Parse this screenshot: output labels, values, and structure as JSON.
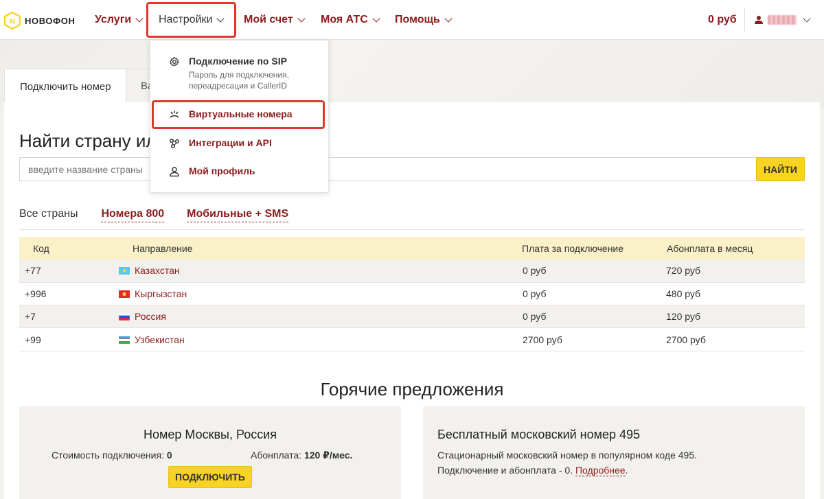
{
  "logo": {
    "text": "НОВОФОН",
    "mark": "N"
  },
  "nav": {
    "items": [
      {
        "label": "Услуги"
      },
      {
        "label": "Настройки"
      },
      {
        "label": "Мой счет"
      },
      {
        "label": "Моя АТС"
      },
      {
        "label": "Помощь"
      }
    ],
    "balance": "0 руб"
  },
  "tabs": [
    {
      "label": "Подключить номер"
    },
    {
      "label": "Ва"
    }
  ],
  "page": {
    "heading": "Найти страну ил",
    "search_placeholder": "введите название страны",
    "search_button": "НАЙТИ"
  },
  "filters": [
    "Все страны",
    "Номера 800",
    "Мобильные + SMS"
  ],
  "table": {
    "headers": [
      "Код",
      "Направление",
      "Плата за подключение",
      "Абонплата в месяц"
    ],
    "rows": [
      {
        "code": "+77",
        "country": "Казахстан",
        "setup": "0 руб",
        "monthly": "720 руб",
        "flag": "kz"
      },
      {
        "code": "+996",
        "country": "Кыргызстан",
        "setup": "0 руб",
        "monthly": "480 руб",
        "flag": "kg"
      },
      {
        "code": "+7",
        "country": "Россия",
        "setup": "0 руб",
        "monthly": "120 руб",
        "flag": "ru"
      },
      {
        "code": "+99",
        "country": "Узбекистан",
        "setup": "2700 руб",
        "monthly": "2700 руб",
        "flag": "uz"
      }
    ]
  },
  "hot": {
    "title": "Горячие предложения",
    "offer1": {
      "title": "Номер Москвы, Россия",
      "cost_label": "Стоимость подключения:",
      "cost_value": "0",
      "fee_label": "Абонплата:",
      "fee_value": "120 ₽/мес.",
      "button": "ПОДКЛЮЧИТЬ"
    },
    "offer2": {
      "title": "Бесплатный московский номер 495",
      "line1": "Стационарный московский номер в популярном коде 495.",
      "line2": "Подключение и абонплата - 0.",
      "more": "Подробнее",
      "dot": "."
    }
  },
  "dropdown": {
    "items": [
      {
        "label": "Подключение по SIP",
        "sub": "Пароль для подключения, переадресация и CallerID",
        "icon": "gear-icon"
      },
      {
        "label": "Виртуальные номера",
        "icon": "numbers-icon"
      },
      {
        "label": "Интеграции и API",
        "icon": "integration-icon"
      },
      {
        "label": "Мой профиль",
        "icon": "profile-icon"
      }
    ]
  },
  "colors": {
    "accent": "#8b1c1c",
    "yellow": "#f9d226",
    "highlight": "#e0372c"
  }
}
